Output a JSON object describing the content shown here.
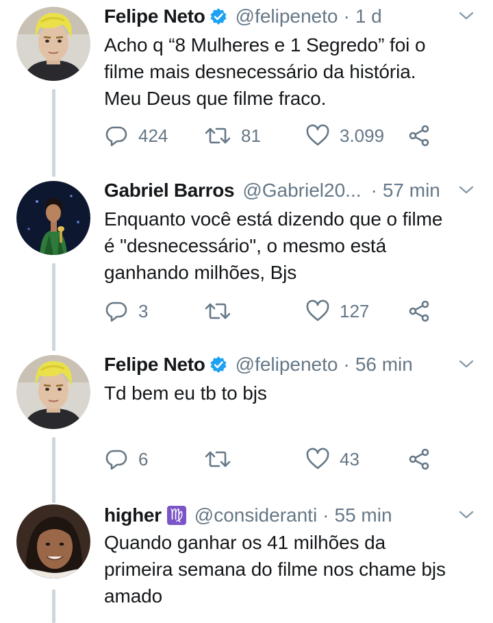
{
  "tweets": [
    {
      "name": "Felipe Neto",
      "verified": true,
      "handle": "@felipeneto",
      "separator": "·",
      "time": "1 d",
      "text": "Acho q “8 Mulheres e 1 Segredo” foi o\nfilme mais desnecessário da história.\nMeu Deus que filme fraco.",
      "replies": "424",
      "retweets": "81",
      "likes": "3.099"
    },
    {
      "name": "Gabriel Barros",
      "verified": false,
      "handle": "@Gabriel20...",
      "separator": "·",
      "time": "57 min",
      "text": "Enquanto você está dizendo que o filme\né \"desnecessário\", o mesmo está\nganhando milhões, Bjs",
      "replies": "3",
      "retweets": "",
      "likes": "127"
    },
    {
      "name": "Felipe Neto",
      "verified": true,
      "handle": "@felipeneto",
      "separator": "·",
      "time": "56 min",
      "text": "Td bem eu tb to bjs",
      "replies": "6",
      "retweets": "",
      "likes": "43"
    },
    {
      "name": "higher",
      "verified": false,
      "sign": "♍",
      "handle": "@consideranti",
      "separator": "·",
      "time": "55 min",
      "text": "Quando ganhar os 41 milhões da\nprimeira semana do filme nos chame bjs\namado"
    }
  ],
  "colors": {
    "text": "#14171a",
    "secondary": "#657786",
    "verified": "#1da1f2",
    "thread_line": "#ccd6dd",
    "sign_badge": "#7b55c7"
  },
  "icons": {
    "reply": "reply-icon",
    "retweet": "retweet-icon",
    "like": "heart-icon",
    "share": "share-icon",
    "menu": "chevron-down-icon",
    "verified": "verified-badge-icon"
  }
}
